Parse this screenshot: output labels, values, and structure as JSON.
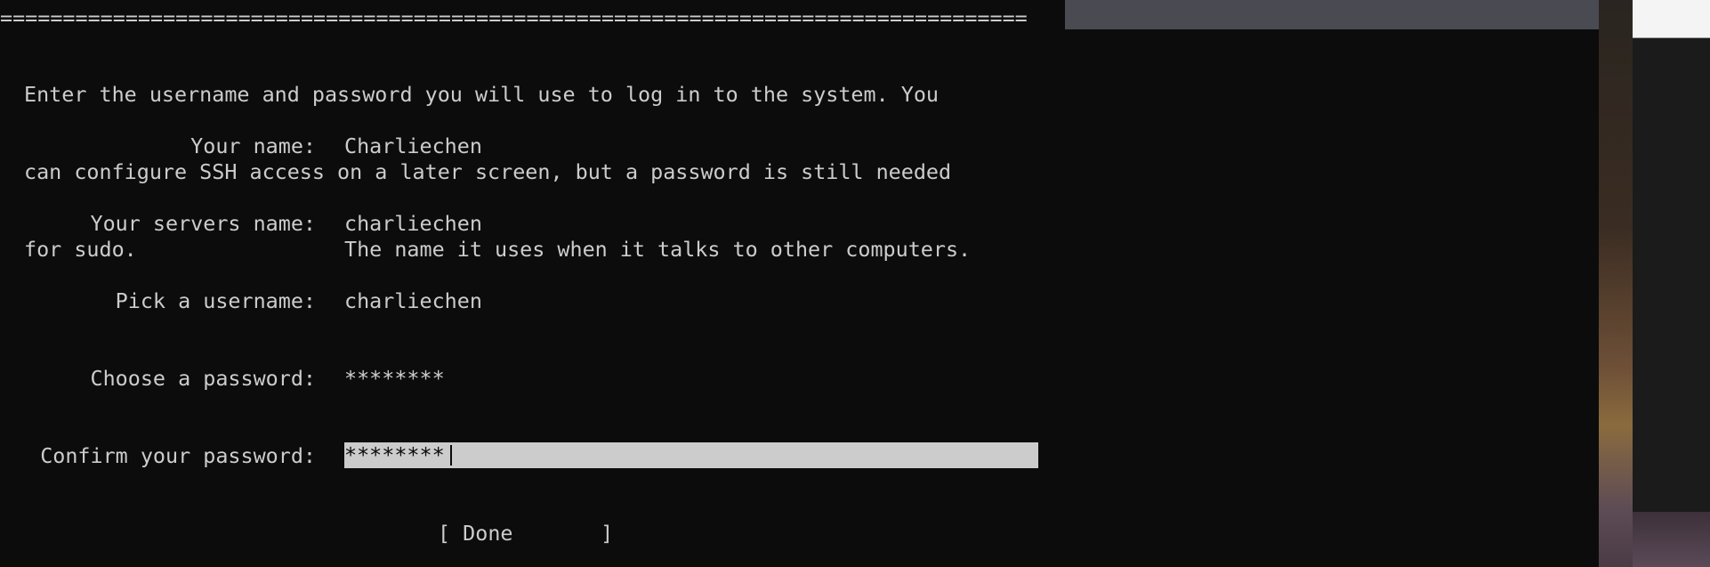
{
  "divider": "==================================================================================",
  "intro": [
    "Enter the username and password you will use to log in to the system. You",
    "can configure SSH access on a later screen, but a password is still needed",
    "for sudo."
  ],
  "form": {
    "name_label": "Your name:",
    "name_value": "Charliechen",
    "server_label": "Your servers name:",
    "server_value": "charliechen",
    "server_hint": "The name it uses when it talks to other computers.",
    "username_label": "Pick a username:",
    "username_value": "charliechen",
    "password_label": "Choose a password:",
    "password_value": "********",
    "confirm_label": "Confirm your password:",
    "confirm_value": "********"
  },
  "done_button": "[ Done       ]",
  "colors": {
    "background": "#0c0c0c",
    "foreground": "#cccccc",
    "highlight": "#cccccc"
  }
}
